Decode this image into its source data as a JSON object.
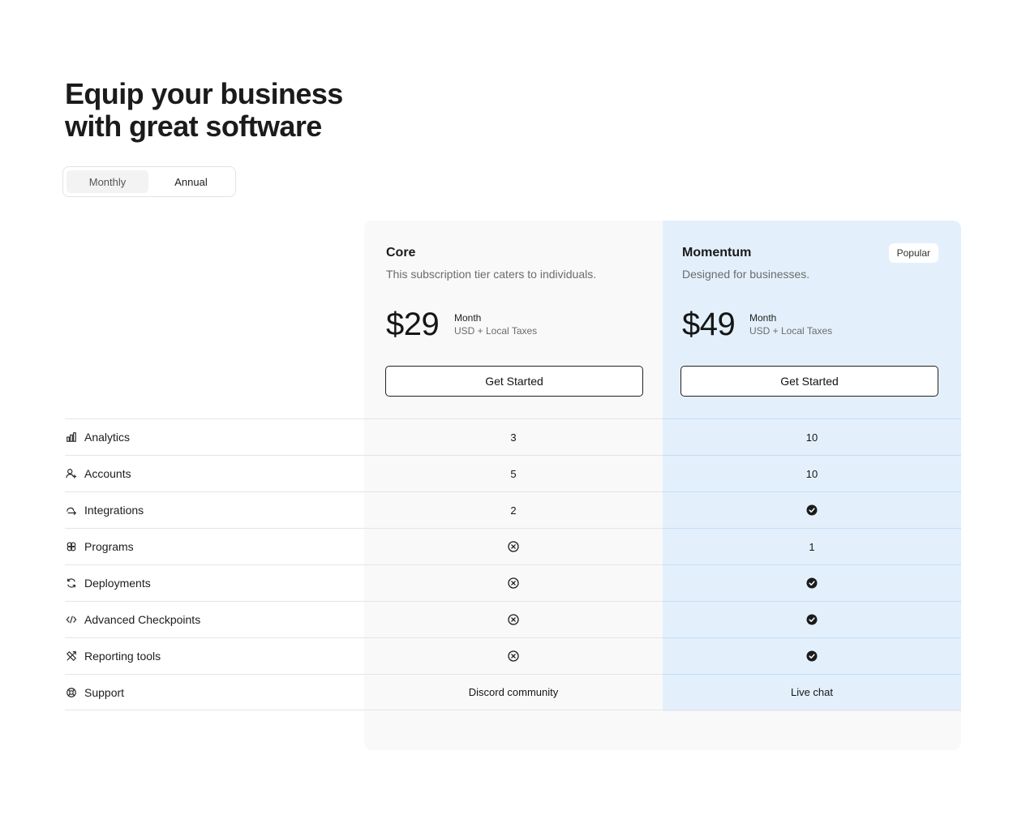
{
  "headline": {
    "line1": "Equip your business",
    "line2": "with great software"
  },
  "billing_toggle": {
    "monthly_label": "Monthly",
    "annual_label": "Annual",
    "selected": "Monthly"
  },
  "plans": [
    {
      "name": "Core",
      "description": "This subscription tier caters to individuals.",
      "price": "$29",
      "period": "Month",
      "taxes": "USD + Local Taxes",
      "cta": "Get Started",
      "background": "#f9f9f9"
    },
    {
      "name": "Momentum",
      "badge": "Popular",
      "description": "Designed for businesses.",
      "price": "$49",
      "period": "Month",
      "taxes": "USD + Local Taxes",
      "cta": "Get Started",
      "background": "#e3f0fc"
    }
  ],
  "features": [
    {
      "label": "Analytics",
      "icon": "bar-chart-icon",
      "core": "3",
      "momentum": "10"
    },
    {
      "label": "Accounts",
      "icon": "user-plus-icon",
      "core": "5",
      "momentum": "10"
    },
    {
      "label": "Integrations",
      "icon": "integration-arrow-icon",
      "core": "2",
      "momentum": "check-icon"
    },
    {
      "label": "Programs",
      "icon": "clover-icon",
      "core": "x-circle-icon",
      "momentum": "1"
    },
    {
      "label": "Deployments",
      "icon": "refresh-icon",
      "core": "x-circle-icon",
      "momentum": "check-icon"
    },
    {
      "label": "Advanced Checkpoints",
      "icon": "code-icon",
      "core": "x-circle-icon",
      "momentum": "check-icon"
    },
    {
      "label": "Reporting tools",
      "icon": "tools-icon",
      "core": "x-circle-icon",
      "momentum": "check-icon"
    },
    {
      "label": "Support",
      "icon": "lifebuoy-icon",
      "core": "Discord community",
      "momentum": "Live chat"
    }
  ]
}
